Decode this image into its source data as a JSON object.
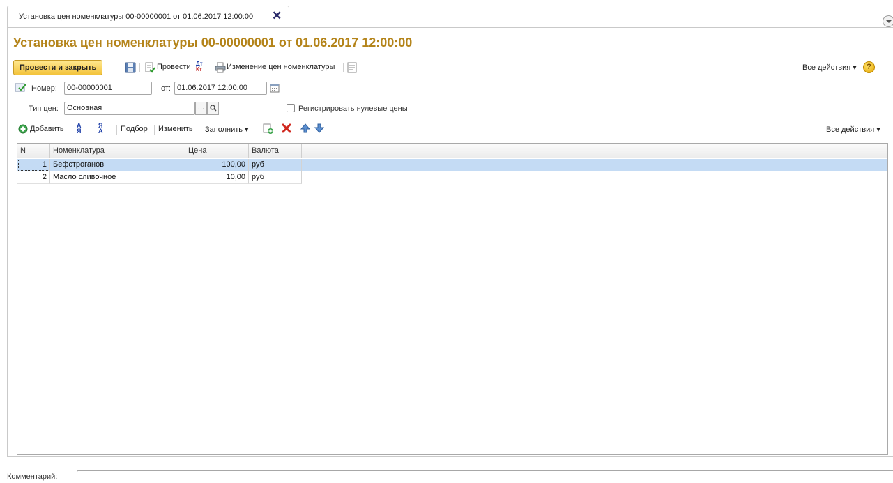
{
  "tab": {
    "title": "Установка цен номенклатуры 00-00000001 от 01.06.2017 12:00:00",
    "close": "✕"
  },
  "document": {
    "title": "Установка цен номенклатуры 00-00000001 от 01.06.2017 12:00:00"
  },
  "toolbar": {
    "post_and_close": "Провести и закрыть",
    "post": "Провести",
    "dtkt": "Дт Кт",
    "print_changes": "Изменение цен номенклатуры",
    "all_actions": "Все действия ▾",
    "help": "?"
  },
  "fields": {
    "number_label": "Номер:",
    "number_value": "00-00000001",
    "date_label": "от:",
    "date_value": "01.06.2017 12:00:00",
    "price_type_label": "Тип цен:",
    "price_type_value": "Основная",
    "price_type_select": "...",
    "zero_prices_label": "Регистрировать нулевые цены"
  },
  "table_toolbar": {
    "add": "Добавить",
    "pick": "Подбор",
    "change": "Изменить",
    "fill": "Заполнить ▾",
    "all_actions": "Все действия ▾"
  },
  "table": {
    "columns": [
      "N",
      "Номенклатура",
      "Цена",
      "Валюта"
    ],
    "rows": [
      {
        "n": "1",
        "item": "Бефстроганов",
        "price": "100,00",
        "currency": "руб"
      },
      {
        "n": "2",
        "item": "Масло сливочное",
        "price": "10,00",
        "currency": "руб"
      }
    ]
  },
  "comment": {
    "label": "Комментарий:",
    "value": ""
  }
}
